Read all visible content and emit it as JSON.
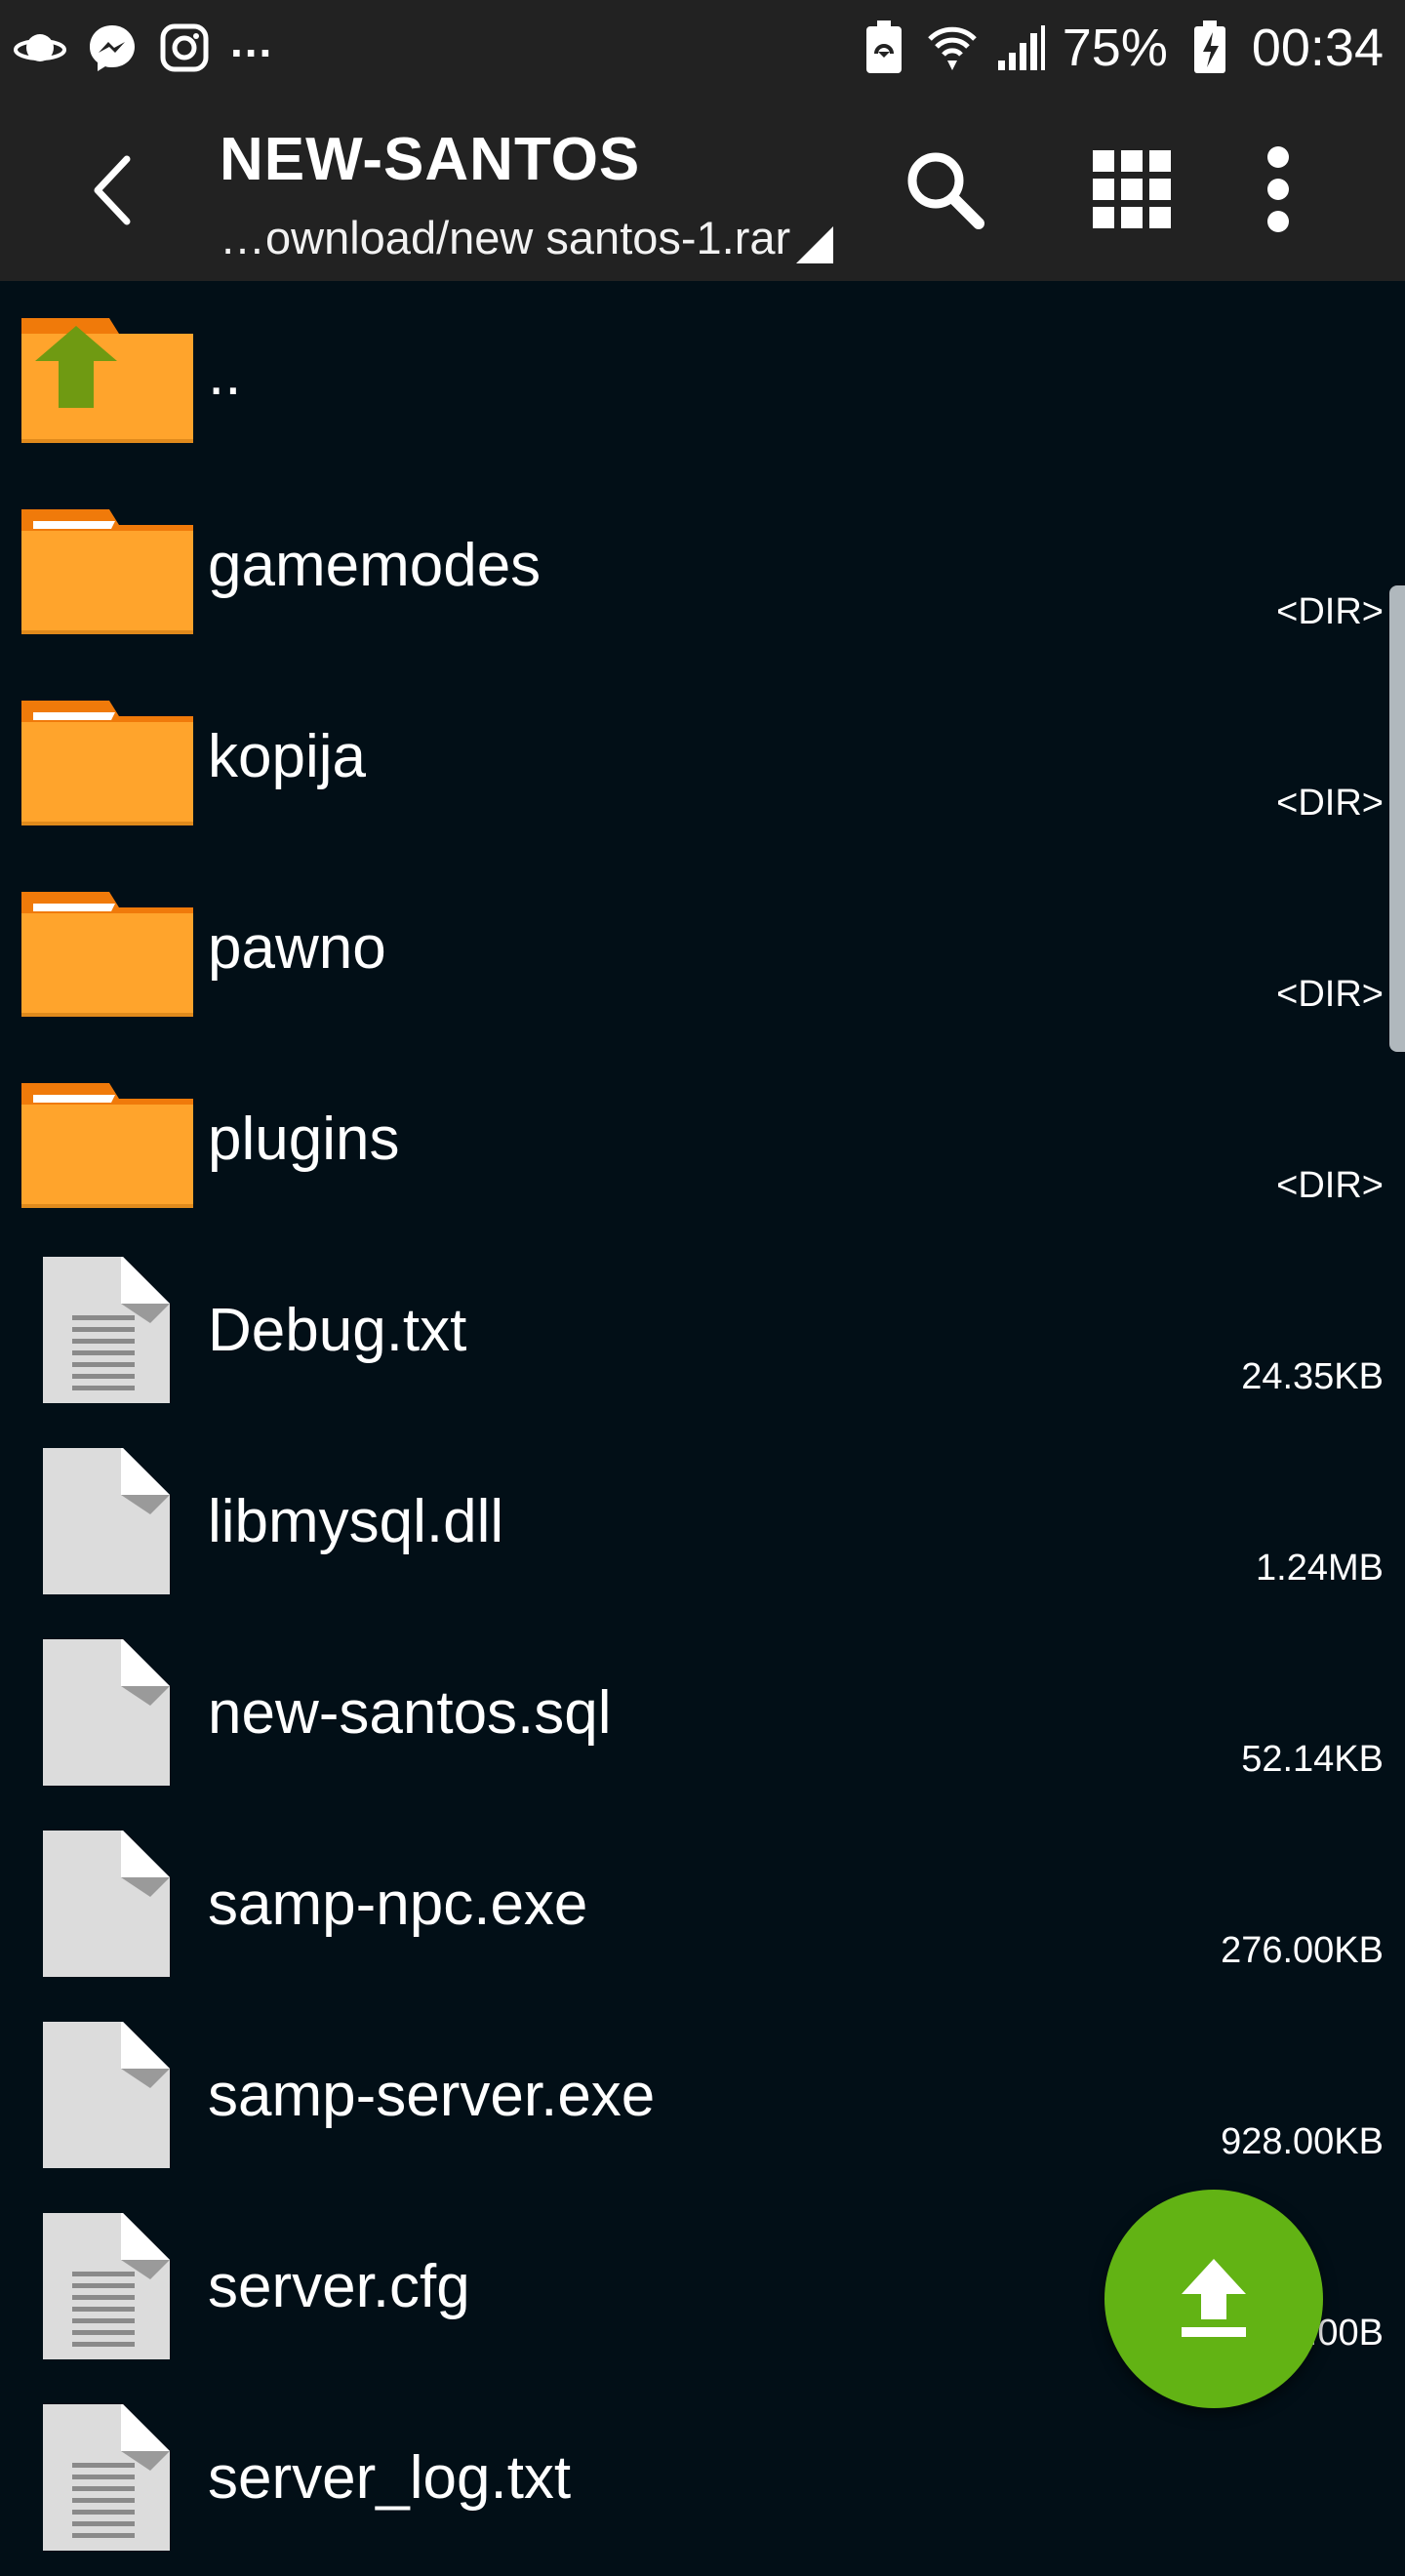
{
  "status_bar": {
    "notification_icons": [
      "saturn-icon",
      "messenger-icon",
      "instagram-icon"
    ],
    "more": "...",
    "battery_percent": "75%",
    "time": "00:34"
  },
  "app_bar": {
    "title": "NEW-SANTOS",
    "path": "…ownload/new santos-1.rar"
  },
  "rows": [
    {
      "name": "..",
      "meta": "",
      "kind": "parent"
    },
    {
      "name": "gamemodes",
      "meta": "<DIR>",
      "kind": "folder"
    },
    {
      "name": "kopija",
      "meta": "<DIR>",
      "kind": "folder"
    },
    {
      "name": "pawno",
      "meta": "<DIR>",
      "kind": "folder"
    },
    {
      "name": "plugins",
      "meta": "<DIR>",
      "kind": "folder"
    },
    {
      "name": "Debug.txt",
      "meta": "24.35KB",
      "kind": "text"
    },
    {
      "name": "libmysql.dll",
      "meta": "1.24MB",
      "kind": "file"
    },
    {
      "name": "new-santos.sql",
      "meta": "52.14KB",
      "kind": "file"
    },
    {
      "name": "samp-npc.exe",
      "meta": "276.00KB",
      "kind": "file"
    },
    {
      "name": "samp-server.exe",
      "meta": "928.00KB",
      "kind": "file"
    },
    {
      "name": "server.cfg",
      "meta": ".00B",
      "kind": "text"
    },
    {
      "name": "server_log.txt",
      "meta": "",
      "kind": "text"
    }
  ],
  "colors": {
    "background": "#020f17",
    "bar": "#222222",
    "folder": "#ffa42c",
    "folder_tab": "#f07a0a",
    "parent_arrow": "#6f9a12",
    "file": "#dcdcdc",
    "fab": "#62b314"
  },
  "fab": {
    "icon": "upload-icon"
  }
}
